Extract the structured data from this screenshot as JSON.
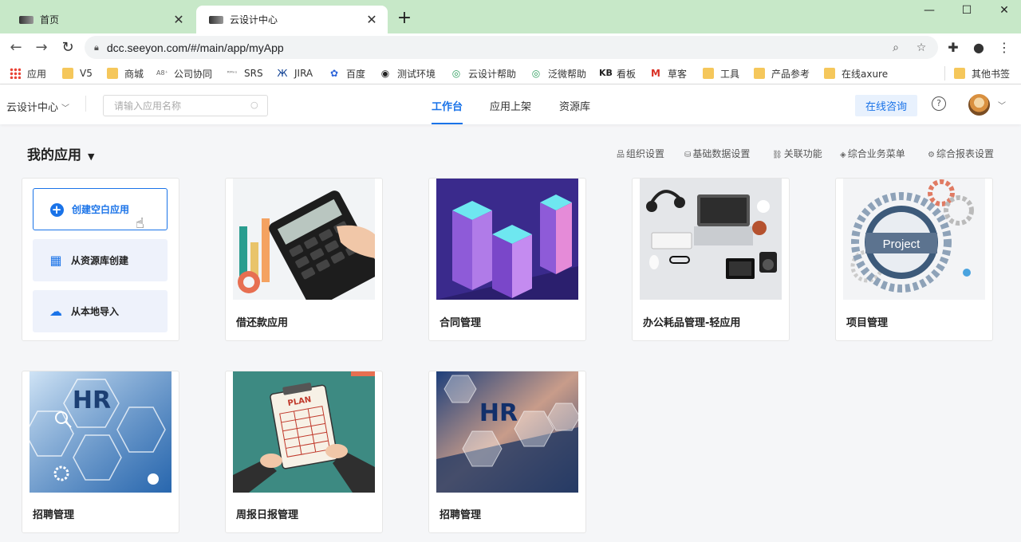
{
  "browser": {
    "tabs": [
      {
        "title": "首页",
        "active": false
      },
      {
        "title": "云设计中心",
        "active": true
      }
    ],
    "url": "dcc.seeyon.com/#/main/app/myApp",
    "bookmarks": [
      {
        "label": "应用",
        "icon": "apps-grid-icon"
      },
      {
        "label": "V5",
        "icon": "folder-icon"
      },
      {
        "label": "商城",
        "icon": "folder-icon"
      },
      {
        "label": "公司协同",
        "icon": "seeyon-icon"
      },
      {
        "label": "SRS",
        "icon": "seeyon-icon"
      },
      {
        "label": "JIRA",
        "icon": "jira-icon"
      },
      {
        "label": "百度",
        "icon": "baidu-icon"
      },
      {
        "label": "测试环境",
        "icon": "globe-icon"
      },
      {
        "label": "云设计帮助",
        "icon": "help-logo-icon"
      },
      {
        "label": "泛微帮助",
        "icon": "help-logo-icon"
      },
      {
        "label": "看板",
        "icon": "kb-icon"
      },
      {
        "label": "草客",
        "icon": "gmail-icon"
      },
      {
        "label": "工具",
        "icon": "folder-icon"
      },
      {
        "label": "产品参考",
        "icon": "folder-icon"
      },
      {
        "label": "在线axure",
        "icon": "folder-icon"
      },
      {
        "label": "其他书签",
        "icon": "folder-icon"
      }
    ]
  },
  "header": {
    "app_selector": "云设计中心",
    "search_placeholder": "请输入应用名称",
    "tabs": [
      {
        "label": "工作台",
        "active": true
      },
      {
        "label": "应用上架",
        "active": false
      },
      {
        "label": "资源库",
        "active": false
      }
    ],
    "consult_label": "在线咨询"
  },
  "main": {
    "title": "我的应用",
    "settings": [
      {
        "label": "组织设置",
        "icon": "org-icon"
      },
      {
        "label": "基础数据设置",
        "icon": "database-icon"
      },
      {
        "label": "关联功能",
        "icon": "link-icon"
      },
      {
        "label": "综合业务菜单",
        "icon": "layers-icon"
      },
      {
        "label": "综合报表设置",
        "icon": "gear-icon"
      }
    ],
    "create": [
      {
        "label": "创建空白应用",
        "icon": "plus-circle-icon"
      },
      {
        "label": "从资源库创建",
        "icon": "grid-icon"
      },
      {
        "label": "从本地导入",
        "icon": "cloud-upload-icon"
      }
    ],
    "apps": [
      {
        "name": "借还款应用",
        "cover": "calculator-image"
      },
      {
        "name": "合同管理",
        "cover": "isometric-buildings-image"
      },
      {
        "name": "办公耗品管理-轻应用",
        "cover": "desk-items-image"
      },
      {
        "name": "项目管理",
        "cover": "project-gears-image"
      },
      {
        "name": "招聘管理",
        "cover": "hr-network-image"
      },
      {
        "name": "周报日报管理",
        "cover": "plan-clipboard-image"
      },
      {
        "name": "招聘管理",
        "cover": "hr-laptop-image"
      }
    ],
    "cover_texts": {
      "project": "Project",
      "hr": "HR",
      "plan": "PLAN"
    }
  },
  "colors": {
    "accent": "#1a73e8",
    "tabstrip": "#c7e8c8"
  }
}
